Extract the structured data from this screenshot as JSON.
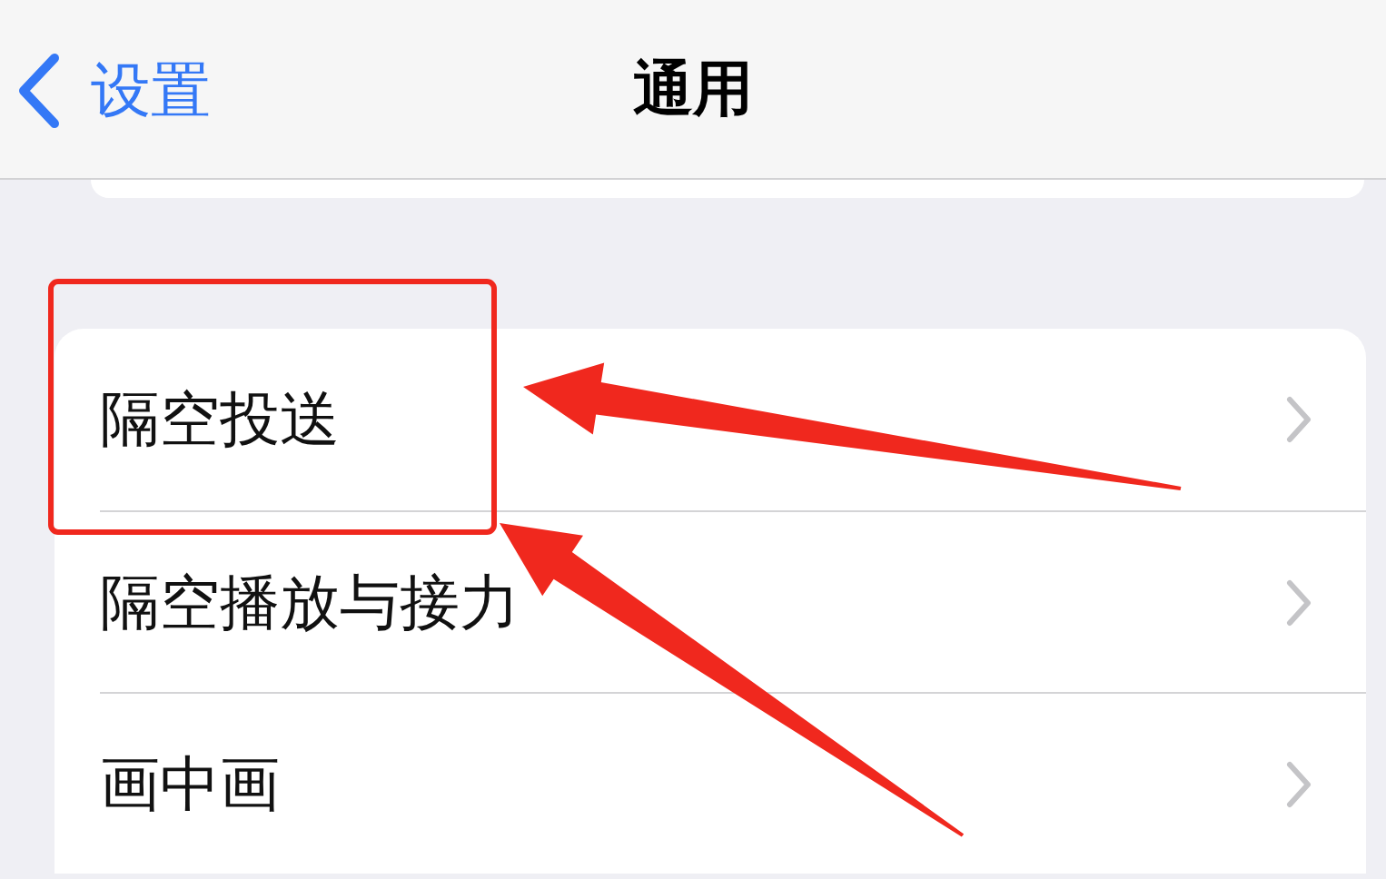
{
  "nav_bar": {
    "back_label": "设置",
    "title": "通用"
  },
  "rows": [
    {
      "label": "隔空投送",
      "highlighted": true
    },
    {
      "label": "隔空播放与接力",
      "highlighted": false
    },
    {
      "label": "画中画",
      "highlighted": false
    }
  ]
}
